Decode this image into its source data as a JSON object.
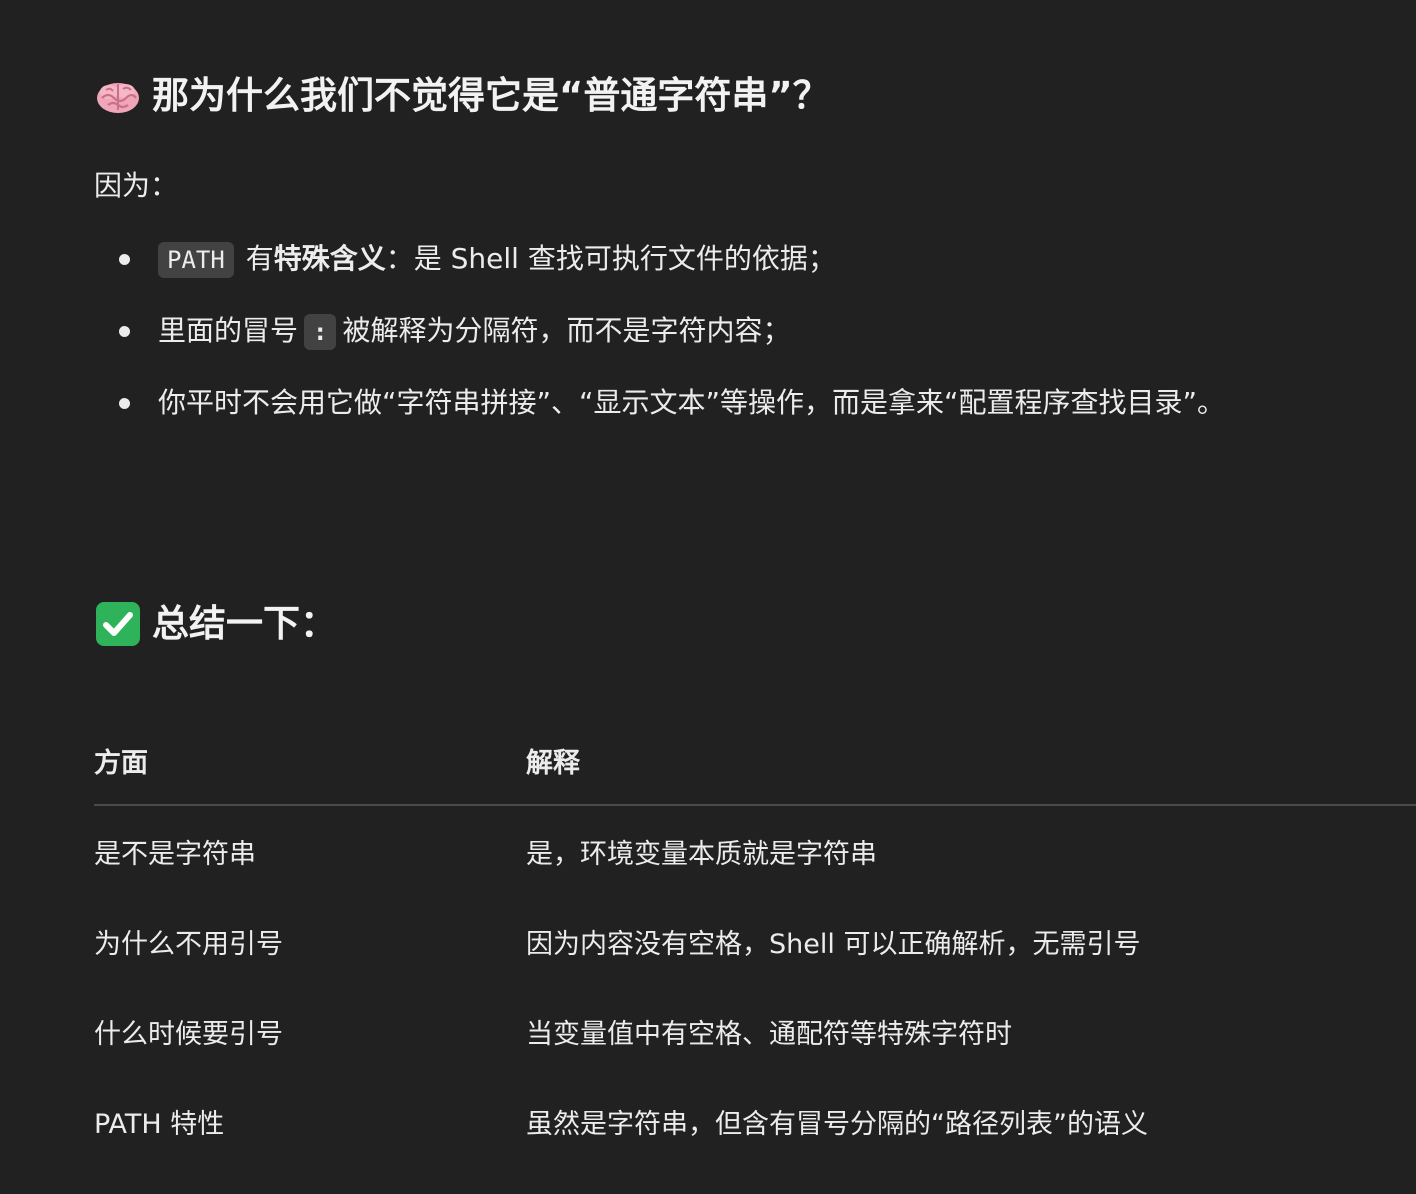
{
  "section_why": {
    "emoji": "brain",
    "heading": "那为什么我们不觉得它是“普通字符串”？"
  },
  "intro": "因为：",
  "bullets": {
    "b1": {
      "code": "PATH",
      "text_before_bold": " 有",
      "bold": "特殊含义",
      "text_after": "：是 Shell 查找可执行文件的依据；"
    },
    "b2": {
      "text_before": "里面的冒号",
      "code": ":",
      "text_after": "被解释为分隔符，而不是字符内容；"
    },
    "b3": {
      "text": "你平时不会用它做“字符串拼接”、“显示文本”等操作，而是拿来“配置程序查找目录”。"
    }
  },
  "section_summary": {
    "emoji": "check-mark-button",
    "heading": "总结一下："
  },
  "table": {
    "headers": [
      "方面",
      "解释"
    ],
    "rows": [
      [
        "是不是字符串",
        "是，环境变量本质就是字符串"
      ],
      [
        "为什么不用引号",
        "因为内容没有空格，Shell 可以正确解析，无需引号"
      ],
      [
        "什么时候要引号",
        "当变量值中有空格、通配符等特殊字符时"
      ],
      [
        "PATH 特性",
        "虽然是字符串，但含有冒号分隔的“路径列表”的语义"
      ]
    ]
  },
  "colors": {
    "background": "#212121",
    "text": "#ececec",
    "code_bg": "#424242",
    "check_green": "#2fb35a",
    "brain_pink": "#f0a5b8"
  }
}
